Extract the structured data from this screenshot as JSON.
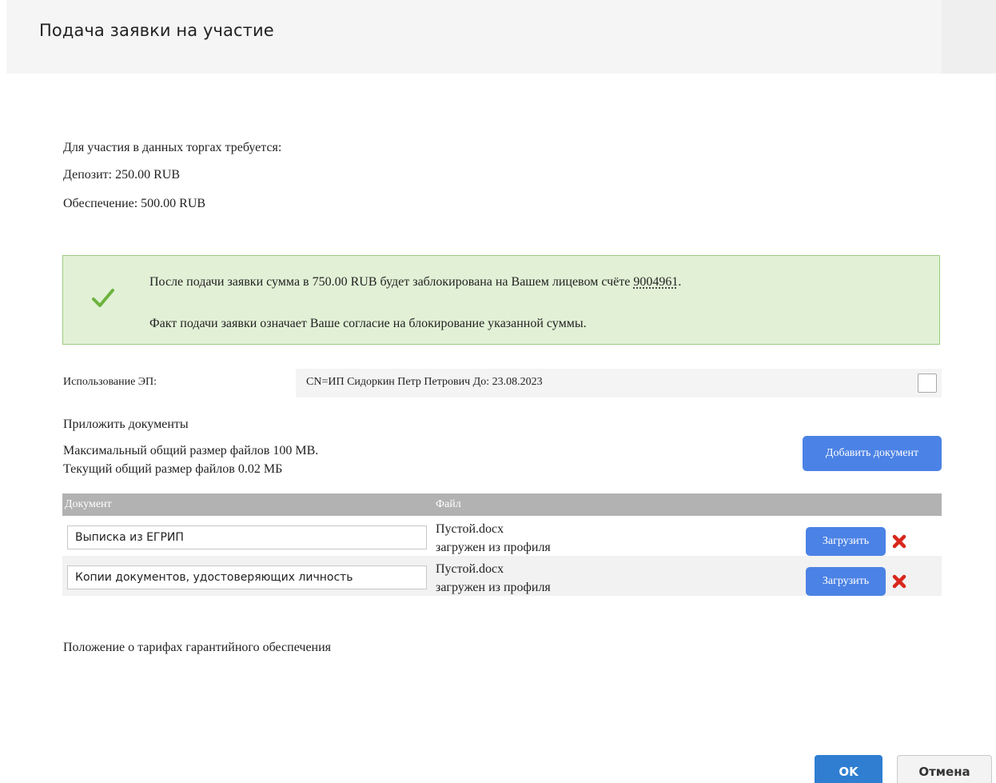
{
  "dialog": {
    "title": "Подача заявки на участие"
  },
  "requirements": {
    "intro": "Для участия в данных торгах требуется:",
    "deposit": "Депозит:  250.00 RUB",
    "security": "Обеспечение:  500.00 RUB"
  },
  "notice": {
    "icon": "checkmark-icon",
    "line1_prefix": "После подачи заявки сумма в 750.00 RUB будет заблокирована на Вашем лицевом счёте ",
    "account": "9004961",
    "line1_suffix": ".",
    "line2": "Факт подачи заявки означает Ваше согласие на блокирование указанной суммы.",
    "colors": {
      "background": "#e2f1d6",
      "border": "#9ccc7f",
      "check": "#6db33f"
    }
  },
  "signature": {
    "label": "Использование ЭП:",
    "value": "CN=ИП Сидоркин Петр Петрович До: 23.08.2023"
  },
  "documents": {
    "heading": "Приложить документы",
    "max_size": "Максимальный общий размер файлов 100 MB.",
    "current_size": "Текущий общий размер файлов 0.02 МБ",
    "add_button": "Добавить документ",
    "columns": {
      "document": "Документ",
      "file": "Файл"
    },
    "rows": [
      {
        "document": "Выписка из ЕГРИП",
        "file_name": "Пустой.docx",
        "file_source": "загружен из профиля",
        "upload_label": "Загрузить"
      },
      {
        "document": "Копии документов, удостоверяющих личность",
        "file_name": "Пустой.docx",
        "file_source": "загружен из профиля",
        "upload_label": "Загрузить"
      }
    ]
  },
  "tariffs_link": "Положение о тарифах гарантийного обеспечения",
  "footer": {
    "ok": "OK",
    "cancel": "Отмена"
  },
  "colors": {
    "primary": "#4b82e5",
    "ok": "#2f7ed1",
    "delete": "#d9261c",
    "table_header": "#b2b2b2"
  }
}
